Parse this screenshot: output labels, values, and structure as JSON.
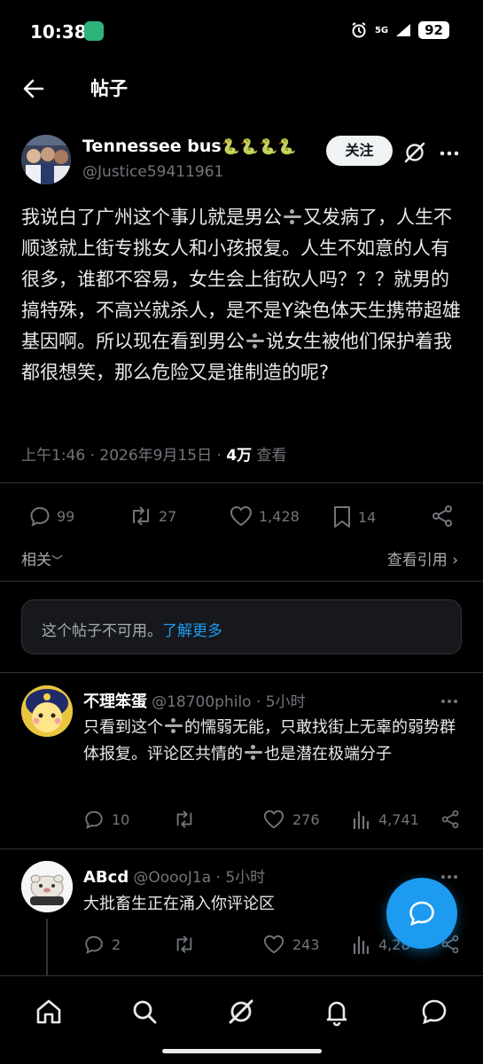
{
  "status_bar": {
    "time": "10:38",
    "signal": "5G",
    "battery": "92"
  },
  "header": {
    "title": "帖子"
  },
  "post": {
    "author_name": "Tennessee bus",
    "author_emojis": "🐍🐍🐍🐍",
    "author_handle": "@Justice59411961",
    "follow_label": "关注",
    "text_1": "我说白了广州这个事儿就是男公",
    "text_2": "又发病了，人生不顺遂就上街专挑女人和小孩报复。人生不如意的人有很多，谁都不容易，女生会上街砍人吗？？？就男的搞特殊，不高兴就杀人，是不是Y染色体天生携带超雄基因啊。所以现在看到男公",
    "text_3": "说女生被他们保护着我都很想笑，那么危险又是谁制造的呢?",
    "meta_time": "上午1:46 · 2026年9月15日 · ",
    "views_count": "4万",
    "views_label": " 查看",
    "replies": "99",
    "reposts": "27",
    "likes": "1,428",
    "bookmarks": "14"
  },
  "related": {
    "label": "相关",
    "view_quotes": "查看引用"
  },
  "unavailable": {
    "text": "这个帖子不可用。",
    "link": "了解更多"
  },
  "replies": [
    {
      "name": "不理笨蛋",
      "handle": "@18700philo · 5小时",
      "text_1": "只看到这个",
      "text_2": "的懦弱无能，只敢找街上无辜的弱势群体报复。评论区共情的",
      "text_3": "也是潜在极端分子",
      "reply_count": "10",
      "repost_count": "",
      "like_count": "276",
      "view_count": "4,741"
    },
    {
      "name": "ABcd",
      "handle": "@OoooJ1a · 5小时",
      "text": "大批畜生正在涌入你评论区",
      "reply_count": "2",
      "repost_count": "",
      "like_count": "243",
      "view_count": "4,28"
    }
  ],
  "colors": {
    "accent": "#1d9bf0",
    "background": "#000000",
    "muted": "#71767b",
    "divider": "#2f3336"
  },
  "icons": {
    "back": "arrow-left-icon",
    "grok": "grok-icon",
    "more": "more-icon",
    "reply": "reply-icon",
    "repost": "repost-icon",
    "like": "heart-icon",
    "bookmark": "bookmark-icon",
    "share": "share-icon",
    "views": "views-icon",
    "compose": "compose-reply-icon",
    "nav": [
      "home-icon",
      "search-icon",
      "grok-icon",
      "bell-icon",
      "messages-icon"
    ]
  }
}
